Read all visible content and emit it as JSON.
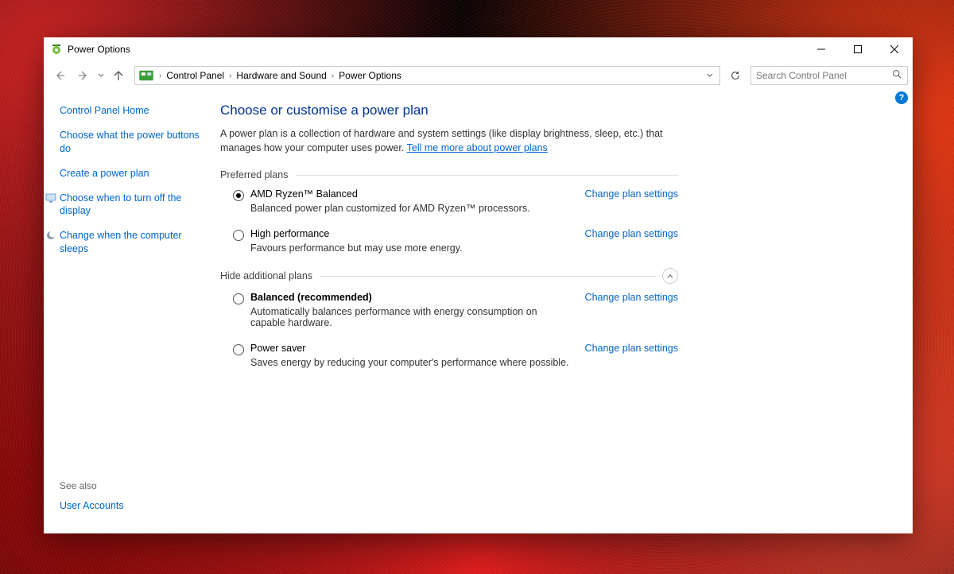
{
  "title": "Power Options",
  "breadcrumb": [
    "Control Panel",
    "Hardware and Sound",
    "Power Options"
  ],
  "search_placeholder": "Search Control Panel",
  "help": "?",
  "sidebar": {
    "home": "Control Panel Home",
    "links": [
      "Choose what the power buttons do",
      "Create a power plan",
      "Choose when to turn off the display",
      "Change when the computer sleeps"
    ],
    "see_also_label": "See also",
    "see_also": [
      "User Accounts"
    ]
  },
  "main": {
    "heading": "Choose or customise a power plan",
    "desc_a": "A power plan is a collection of hardware and system settings (like display brightness, sleep, etc.) that manages how your computer uses power. ",
    "desc_link": "Tell me more about power plans",
    "preferred_label": "Preferred plans",
    "additional_label": "Hide additional plans",
    "change_link": "Change plan settings",
    "plans_preferred": [
      {
        "name": "AMD Ryzen™ Balanced",
        "desc": "Balanced power plan customized for AMD Ryzen™ processors.",
        "checked": true,
        "bold": false
      },
      {
        "name": "High performance",
        "desc": "Favours performance but may use more energy.",
        "checked": false,
        "bold": false
      }
    ],
    "plans_additional": [
      {
        "name": "Balanced (recommended)",
        "desc": "Automatically balances performance with energy consumption on capable hardware.",
        "checked": false,
        "bold": true
      },
      {
        "name": "Power saver",
        "desc": "Saves energy by reducing your computer's performance where possible.",
        "checked": false,
        "bold": false
      }
    ]
  }
}
